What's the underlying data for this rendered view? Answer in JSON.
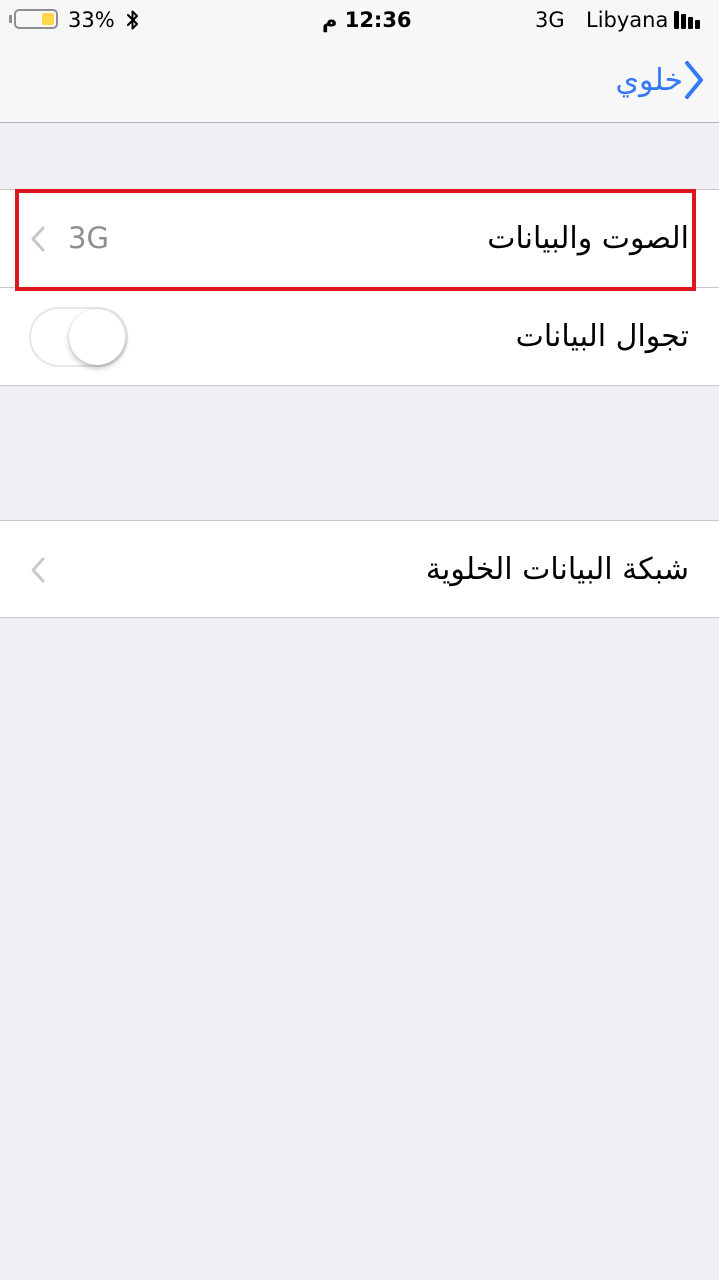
{
  "status_bar": {
    "battery_percent": "33%",
    "battery_level": 0.33,
    "time": "12:36 م",
    "network": "3G",
    "carrier": "Libyana"
  },
  "nav": {
    "back_label": "خلوي"
  },
  "rows": [
    {
      "label": "الصوت والبيانات",
      "value": "3G"
    },
    {
      "label": "تجوال البيانات",
      "toggle_on": false
    },
    {
      "label": "شبكة البيانات الخلوية"
    }
  ],
  "colors": {
    "accent": "#3478f6",
    "highlight": "#e0161f",
    "background": "#efeff4",
    "battery_fill": "#ffd84a"
  },
  "icons": [
    "battery-icon",
    "bluetooth-icon",
    "signal-icon",
    "back-chevron-icon",
    "chevron-left-icon"
  ]
}
